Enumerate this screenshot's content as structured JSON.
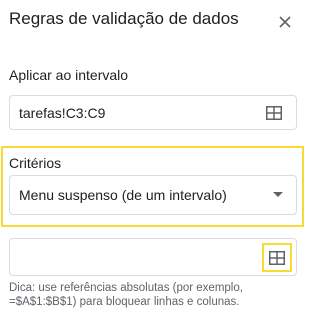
{
  "panel": {
    "title": "Regras de validação de dados",
    "close_icon": "close-icon"
  },
  "range": {
    "label": "Aplicar ao intervalo",
    "value": "tarefas!C3:C9",
    "select_icon": "grid-select-icon"
  },
  "criteria": {
    "label": "Critérios",
    "selected_option": "Menu suspenso (de um intervalo)",
    "arrow_icon": "dropdown-arrow-icon",
    "source_value": "",
    "source_icon": "grid-select-icon",
    "hint": "Dica: use referências absolutas (por exemplo, =$A$1:$B$1) para bloquear linhas e colunas."
  },
  "colors": {
    "highlight": "#fbd935",
    "border": "#dadce0",
    "text": "#202124",
    "hint_text": "#5f6368"
  }
}
